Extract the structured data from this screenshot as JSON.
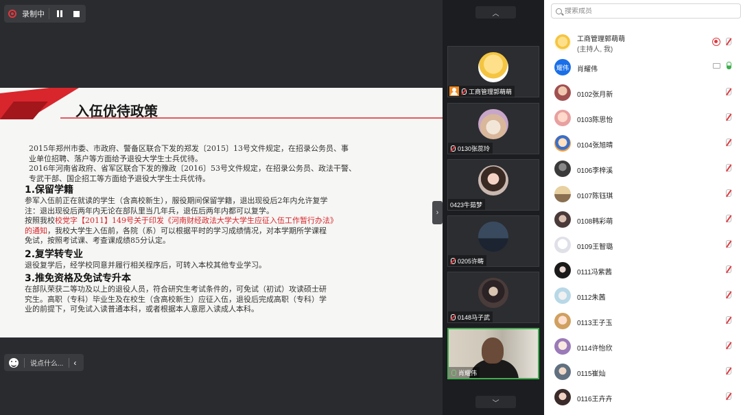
{
  "recording": {
    "label": "录制中"
  },
  "slide": {
    "title": "入伍优待政策",
    "intro": [
      "2015年郑州市委、市政府、警备区联合下发的郑发〔2015〕13号文件规定，在招录公务员、事",
      "业单位招聘、落户等方面给予退役大学生士兵优待。",
      "2016年河南省政府、省军区联合下发的豫政〔2016〕53号文件规定，在招录公务员、政法干警、",
      "专武干部、国企招工等方面给予退役大学生士兵优待。"
    ],
    "section1": {
      "heading": "1.保留学籍",
      "lines": [
        "参军入伍前正在就读的学生（含高校新生），服役期间保留学籍，退出现役后2年内允许复学",
        "注：退出现役后两年内无论在部队里当几年兵，退伍后两年内都可以复学。"
      ],
      "line3_prefix": "按照我校",
      "line3_red": "校党字【2011】149号关于印发《河南财经政法大学大学生应征入伍工作暂行办法》",
      "line4_red": "的通知",
      "line4_rest": "，我校大学生入伍前，各院（系）可以根据平时的学习成绩情况，对本学期所学课程",
      "line5": "免试，按照考试课、考查课成绩85分认定。"
    },
    "section2": {
      "heading": "2.复学转专业",
      "lines": [
        "退役复学后，经学校同意并履行相关程序后，可转入本校其他专业学习。"
      ]
    },
    "section3": {
      "heading": "3.推免资格及免试专升本",
      "lines": [
        "在部队荣获二等功及以上的退役人员，符合研究生考试条件的，可免试（初试）攻读硕士研",
        "究生。高职（专科）毕业生及在校生（含高校新生）应征入伍，退役后完成高职（专科）学",
        "业的前提下，可免试入读普通本科，或者根据本人意愿入读成人本科。"
      ]
    }
  },
  "chat": {
    "placeholder": "说点什么..."
  },
  "video_tiles": [
    {
      "name": "工商管理郭萌萌"
    },
    {
      "name": "0130张蕊玲"
    },
    {
      "name": "0423牛茹梦"
    },
    {
      "name": "0205许畴"
    },
    {
      "name": "0148马子武"
    },
    {
      "name": "肖耀伟"
    }
  ],
  "members_panel": {
    "search_placeholder": "搜索成员",
    "host": {
      "name": "工商管理郭萌萌",
      "sub": "(主持人, 我)"
    },
    "second": {
      "name": "肖耀伟",
      "avatar_text": "耀伟"
    },
    "members": [
      "0102张月新",
      "0103陈思怡",
      "0104张旭晴",
      "0106李梓溪",
      "0107陈钰琪",
      "0108韩彩萌",
      "0109王智璐",
      "0111冯紫茜",
      "0112朱茜",
      "0113王子玉",
      "0114许怡欣",
      "0115崔灿",
      "0116王卉卉"
    ]
  },
  "colors": {
    "accent_red": "#d8262c",
    "active_green": "#3fae4e",
    "avatar_blue": "#1a6fe8"
  }
}
